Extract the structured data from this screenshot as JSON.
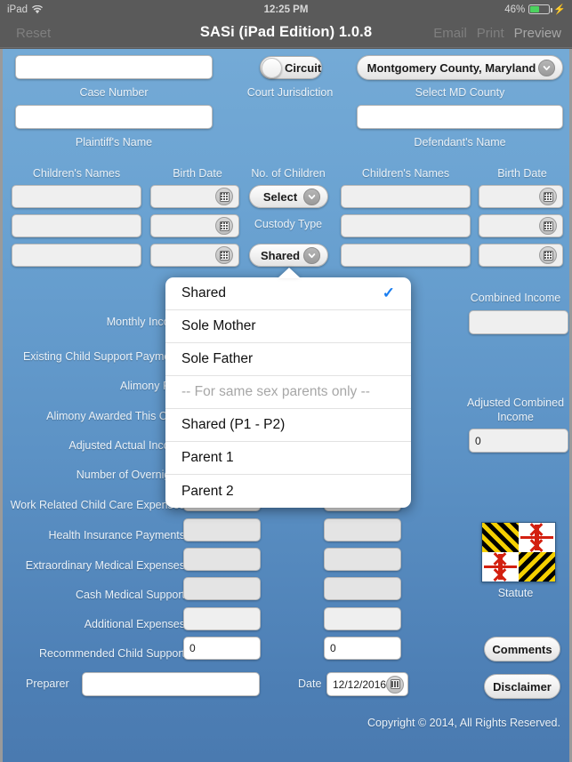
{
  "status_bar": {
    "device": "iPad",
    "wifi_icon": "wifi-icon",
    "time": "12:25 PM",
    "battery_percent": "46%",
    "battery_level": 46,
    "charging_icon": "lightning-bolt-icon"
  },
  "nav_bar": {
    "reset_label": "Reset",
    "title": "SASi (iPad Edition) 1.0.8",
    "email_label": "Email",
    "print_label": "Print",
    "preview_label": "Preview"
  },
  "form": {
    "case_number": {
      "label": "Case Number",
      "value": ""
    },
    "court_jurisdiction": {
      "label": "Court Jurisdiction",
      "toggle_label": "Circuit",
      "state": "off"
    },
    "select_md_county": {
      "label": "Select MD County",
      "value": "Montgomery County, Maryland",
      "chevron_icon": "chevron-down-icon"
    },
    "plaintiff_name": {
      "label": "Plaintiff's Name",
      "value": ""
    },
    "defendant_name": {
      "label": "Defendant's Name",
      "value": ""
    }
  },
  "children": {
    "left_names_header": "Children's Names",
    "left_birth_header": "Birth Date",
    "center_header": "No. of Children",
    "right_names_header": "Children's Names",
    "right_birth_header": "Birth Date",
    "no_of_children": {
      "value": "Select",
      "chevron_icon": "chevron-down-icon"
    },
    "custody_type_label": "Custody Type",
    "custody_type": {
      "value": "Shared",
      "chevron_icon": "chevron-down-icon"
    },
    "left_rows": [
      {
        "name": "",
        "birth_date": "",
        "calendar_icon": "calendar-icon"
      },
      {
        "name": "",
        "birth_date": "",
        "calendar_icon": "calendar-icon"
      },
      {
        "name": "",
        "birth_date": "",
        "calendar_icon": "calendar-icon"
      }
    ],
    "right_rows": [
      {
        "name": "",
        "birth_date": "",
        "calendar_icon": "calendar-icon"
      },
      {
        "name": "",
        "birth_date": "",
        "calendar_icon": "calendar-icon"
      },
      {
        "name": "",
        "birth_date": "",
        "calendar_icon": "calendar-icon"
      }
    ]
  },
  "custody_popover": {
    "visible": true,
    "selected": "Shared",
    "check_icon": "checkmark-icon",
    "items": [
      {
        "label": "Shared",
        "checked": true,
        "muted": false
      },
      {
        "label": "Sole Mother",
        "checked": false,
        "muted": false
      },
      {
        "label": "Sole Father",
        "checked": false,
        "muted": false
      },
      {
        "label": "-- For same sex parents only --",
        "checked": false,
        "muted": true
      },
      {
        "label": "Shared (P1 - P2)",
        "checked": false,
        "muted": false
      },
      {
        "label": "Parent 1",
        "checked": false,
        "muted": false
      },
      {
        "label": "Parent 2",
        "checked": false,
        "muted": false
      }
    ]
  },
  "finance_rows": [
    {
      "label": "Monthly Income",
      "left_value": "",
      "right_value": ""
    },
    {
      "label": "Existing Child Support Payments",
      "left_value": "",
      "right_value": ""
    },
    {
      "label": "Alimony Paid",
      "left_value": "",
      "right_value": ""
    },
    {
      "label": "Alimony Awarded This Case",
      "left_value": "",
      "right_value": ""
    },
    {
      "label": "Adjusted Actual Income",
      "left_value": "",
      "right_value": ""
    },
    {
      "label": "Number of Overnights",
      "left_value": "",
      "right_value": ""
    },
    {
      "label": "Work Related Child Care Expenses",
      "left_value": "",
      "right_value": ""
    },
    {
      "label": "Health Insurance Payments",
      "left_value": "",
      "right_value": ""
    },
    {
      "label": "Extraordinary Medical Expenses",
      "left_value": "",
      "right_value": ""
    },
    {
      "label": "Cash Medical Support",
      "left_value": "",
      "right_value": ""
    },
    {
      "label": "Additional Expenses",
      "left_value": "",
      "right_value": ""
    },
    {
      "label": "Recommended Child Support",
      "left_value": "0",
      "right_value": "0"
    }
  ],
  "sidebar": {
    "combined_income_label": "Combined Income",
    "combined_income_value": "",
    "adjusted_combined_income_label": "Adjusted Combined Income",
    "adjusted_combined_income_value": "0",
    "statute_label": "Statute",
    "statute_icon": "maryland-flag-icon",
    "comments_label": "Comments",
    "disclaimer_label": "Disclaimer"
  },
  "footer": {
    "preparer_label": "Preparer",
    "preparer_value": "",
    "date_label": "Date",
    "date_value": "12/12/2016",
    "calendar_icon": "calendar-icon",
    "copyright": "Copyright © 2014, All Rights Reserved."
  },
  "colors": {
    "canvas_top": "#74aad6",
    "canvas_bottom": "#4a7ab0",
    "chrome": "#5a5a5a",
    "accent_check": "#1a7ef0",
    "battery_green": "#4cd25f"
  }
}
